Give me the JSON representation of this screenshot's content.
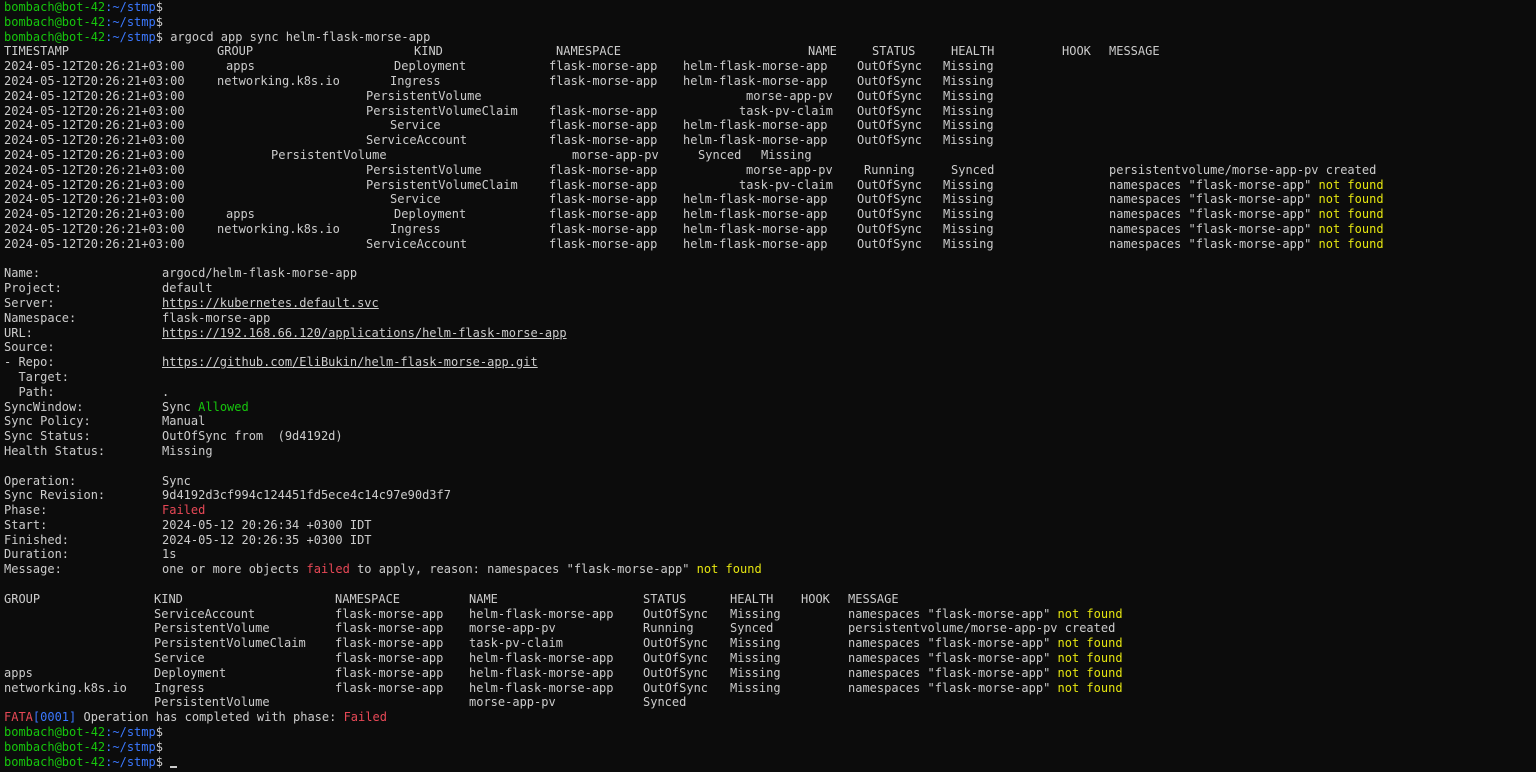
{
  "prompt": {
    "user_host": "bombach@bot-42",
    "path": ":~/stmp",
    "sign": "$"
  },
  "command": "argocd app sync helm-flask-morse-app",
  "sync_table": {
    "headers": [
      "TIMESTAMP",
      "GROUP",
      "KIND",
      "NAMESPACE",
      "NAME",
      "STATUS",
      "HEALTH",
      "HOOK",
      "MESSAGE"
    ],
    "rows": [
      {
        "ts": "2024-05-12T20:26:21+03:00",
        "group": "apps",
        "kind": "Deployment",
        "ns": "flask-morse-app",
        "name": "helm-flask-morse-app",
        "status": "OutOfSync",
        "health": "Missing",
        "msg": ""
      },
      {
        "ts": "2024-05-12T20:26:21+03:00",
        "group": "networking.k8s.io",
        "kind": "Ingress",
        "ns": "flask-morse-app",
        "name": "helm-flask-morse-app",
        "status": "OutOfSync",
        "health": "Missing",
        "msg": ""
      },
      {
        "ts": "2024-05-12T20:26:21+03:00",
        "group": "",
        "kind": "PersistentVolume",
        "ns": "",
        "name": "morse-app-pv",
        "status": "OutOfSync",
        "health": "Missing",
        "msg": ""
      },
      {
        "ts": "2024-05-12T20:26:21+03:00",
        "group": "",
        "kind": "PersistentVolumeClaim",
        "ns": "flask-morse-app",
        "name": "task-pv-claim",
        "status": "OutOfSync",
        "health": "Missing",
        "msg": ""
      },
      {
        "ts": "2024-05-12T20:26:21+03:00",
        "group": "",
        "kind": "Service",
        "ns": "flask-morse-app",
        "name": "helm-flask-morse-app",
        "status": "OutOfSync",
        "health": "Missing",
        "msg": ""
      },
      {
        "ts": "2024-05-12T20:26:21+03:00",
        "group": "",
        "kind": "ServiceAccount",
        "ns": "flask-morse-app",
        "name": "helm-flask-morse-app",
        "status": "OutOfSync",
        "health": "Missing",
        "msg": ""
      },
      {
        "ts": "2024-05-12T20:26:21+03:00",
        "group": "",
        "kind": "PersistentVolume",
        "ns": "",
        "name": "morse-app-pv",
        "status": "Synced",
        "health": "Missing",
        "msg": ""
      },
      {
        "ts": "2024-05-12T20:26:21+03:00",
        "group": "",
        "kind": "PersistentVolume",
        "ns": "flask-morse-app",
        "name": "morse-app-pv",
        "status": "Running",
        "health": "Synced",
        "msg": "persistentvolume/morse-app-pv created"
      },
      {
        "ts": "2024-05-12T20:26:21+03:00",
        "group": "",
        "kind": "PersistentVolumeClaim",
        "ns": "flask-morse-app",
        "name": "task-pv-claim",
        "status": "OutOfSync",
        "health": "Missing",
        "msg": "namespaces \"flask-morse-app\"",
        "msg_tail": "not found"
      },
      {
        "ts": "2024-05-12T20:26:21+03:00",
        "group": "",
        "kind": "Service",
        "ns": "flask-morse-app",
        "name": "helm-flask-morse-app",
        "status": "OutOfSync",
        "health": "Missing",
        "msg": "namespaces \"flask-morse-app\"",
        "msg_tail": "not found"
      },
      {
        "ts": "2024-05-12T20:26:21+03:00",
        "group": "apps",
        "kind": "Deployment",
        "ns": "flask-morse-app",
        "name": "helm-flask-morse-app",
        "status": "OutOfSync",
        "health": "Missing",
        "msg": "namespaces \"flask-morse-app\"",
        "msg_tail": "not found"
      },
      {
        "ts": "2024-05-12T20:26:21+03:00",
        "group": "networking.k8s.io",
        "kind": "Ingress",
        "ns": "flask-morse-app",
        "name": "helm-flask-morse-app",
        "status": "OutOfSync",
        "health": "Missing",
        "msg": "namespaces \"flask-morse-app\"",
        "msg_tail": "not found"
      },
      {
        "ts": "2024-05-12T20:26:21+03:00",
        "group": "",
        "kind": "ServiceAccount",
        "ns": "flask-morse-app",
        "name": "helm-flask-morse-app",
        "status": "OutOfSync",
        "health": "Missing",
        "msg": "namespaces \"flask-morse-app\"",
        "msg_tail": "not found"
      }
    ]
  },
  "app_info": {
    "name_label": "Name:",
    "name": "argocd/helm-flask-morse-app",
    "project_label": "Project:",
    "project": "default",
    "server_label": "Server:",
    "server": "https://kubernetes.default.svc",
    "namespace_label": "Namespace:",
    "namespace": "flask-morse-app",
    "url_label": "URL:",
    "url": "https://192.168.66.120/applications/helm-flask-morse-app",
    "source_label": "Source:",
    "repo_label": "- Repo:",
    "repo": "https://github.com/EliBukin/helm-flask-morse-app.git",
    "target_label": "  Target:",
    "path_label": "  Path:",
    "path": ".",
    "syncwindow_label": "SyncWindow:",
    "syncwindow_prefix": "Sync",
    "syncwindow_status": "Allowed",
    "sync_policy_label": "Sync Policy:",
    "sync_policy": "Manual",
    "sync_status_label": "Sync Status:",
    "sync_status": "OutOfSync from  (9d4192d)",
    "health_label": "Health Status:",
    "health": "Missing"
  },
  "operation": {
    "operation_label": "Operation:",
    "operation": "Sync",
    "revision_label": "Sync Revision:",
    "revision": "9d4192d3cf994c124451fd5ece4c14c97e90d3f7",
    "phase_label": "Phase:",
    "phase": "Failed",
    "start_label": "Start:",
    "start": "2024-05-12 20:26:34 +0300 IDT",
    "finished_label": "Finished:",
    "finished": "2024-05-12 20:26:35 +0300 IDT",
    "duration_label": "Duration:",
    "duration": "1s",
    "message_label": "Message:",
    "message_part1": "one or more objects ",
    "message_failed": "failed",
    "message_part2": " to apply, reason: namespaces \"flask-morse-app\" ",
    "message_tail": "not found"
  },
  "result_table": {
    "headers": [
      "GROUP",
      "KIND",
      "NAMESPACE",
      "NAME",
      "STATUS",
      "HEALTH",
      "HOOK",
      "MESSAGE"
    ],
    "rows": [
      {
        "group": "",
        "kind": "ServiceAccount",
        "ns": "flask-morse-app",
        "name": "helm-flask-morse-app",
        "status": "OutOfSync",
        "health": "Missing",
        "msg": "namespaces \"flask-morse-app\"",
        "msg_tail": "not found"
      },
      {
        "group": "",
        "kind": "PersistentVolume",
        "ns": "flask-morse-app",
        "name": "morse-app-pv",
        "status": "Running",
        "health": "Synced",
        "msg": "persistentvolume/morse-app-pv created"
      },
      {
        "group": "",
        "kind": "PersistentVolumeClaim",
        "ns": "flask-morse-app",
        "name": "task-pv-claim",
        "status": "OutOfSync",
        "health": "Missing",
        "msg": "namespaces \"flask-morse-app\"",
        "msg_tail": "not found"
      },
      {
        "group": "",
        "kind": "Service",
        "ns": "flask-morse-app",
        "name": "helm-flask-morse-app",
        "status": "OutOfSync",
        "health": "Missing",
        "msg": "namespaces \"flask-morse-app\"",
        "msg_tail": "not found"
      },
      {
        "group": "apps",
        "kind": "Deployment",
        "ns": "flask-morse-app",
        "name": "helm-flask-morse-app",
        "status": "OutOfSync",
        "health": "Missing",
        "msg": "namespaces \"flask-morse-app\"",
        "msg_tail": "not found"
      },
      {
        "group": "networking.k8s.io",
        "kind": "Ingress",
        "ns": "flask-morse-app",
        "name": "helm-flask-morse-app",
        "status": "OutOfSync",
        "health": "Missing",
        "msg": "namespaces \"flask-morse-app\"",
        "msg_tail": "not found"
      },
      {
        "group": "",
        "kind": "PersistentVolume",
        "ns": "",
        "name": "morse-app-pv",
        "status": "Synced",
        "health": "",
        "msg": ""
      }
    ]
  },
  "fatal": {
    "prefix": "FATA",
    "code": "[0001]",
    "text": " Operation has completed with phase: ",
    "phase": "Failed"
  }
}
